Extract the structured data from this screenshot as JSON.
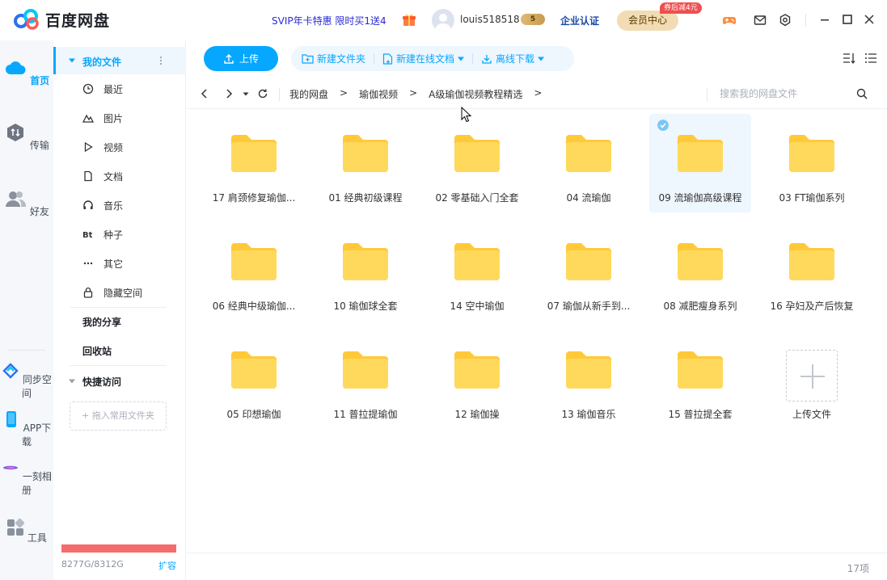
{
  "app": {
    "title": "百度网盘",
    "promo": "SVIP年卡特惠 限时买1送4",
    "username": "louis518518",
    "vip_badge": "5",
    "enterprise": "企业认证",
    "member_center": "会员中心",
    "member_tag": "券后减4元"
  },
  "rail": {
    "items": [
      {
        "label": "首页",
        "icon": "cloud-icon"
      },
      {
        "label": "传输",
        "icon": "transfer-icon"
      },
      {
        "label": "好友",
        "icon": "friends-icon"
      },
      {
        "label": "同步空间",
        "icon": "sync-icon"
      },
      {
        "label": "APP下载",
        "icon": "phone-icon"
      },
      {
        "label": "一刻相册",
        "icon": "album-icon"
      },
      {
        "label": "工具",
        "icon": "tools-icon"
      }
    ]
  },
  "sidebar": {
    "my_files": "我的文件",
    "items": [
      {
        "label": "最近",
        "icon": "clock-icon"
      },
      {
        "label": "图片",
        "icon": "image-icon"
      },
      {
        "label": "视频",
        "icon": "play-icon"
      },
      {
        "label": "文档",
        "icon": "document-icon"
      },
      {
        "label": "音乐",
        "icon": "headphone-icon"
      },
      {
        "label": "种子",
        "icon": "bt-icon"
      },
      {
        "label": "其它",
        "icon": "more-icon"
      },
      {
        "label": "隐藏空间",
        "icon": "lock-icon"
      }
    ],
    "my_share": "我的分享",
    "recycle_bin": "回收站",
    "quick_access": "快捷访问",
    "drop_hint": "+ 拖入常用文件夹",
    "storage": "8277G/8312G",
    "storage_used_fraction": 0.996,
    "expand": "扩容"
  },
  "toolbar": {
    "upload": "上传",
    "new_folder": "新建文件夹",
    "new_online_doc": "新建在线文档",
    "offline_download": "离线下载"
  },
  "breadcrumb": {
    "items": [
      "我的网盘",
      "瑜伽视频",
      "A级瑜伽视频教程精选"
    ],
    "separator": ">",
    "search_placeholder": "搜索我的网盘文件"
  },
  "files": [
    {
      "name": "17 肩颈修复瑜伽..."
    },
    {
      "name": "01 经典初级课程"
    },
    {
      "name": "02 零基础入门全套"
    },
    {
      "name": "04 流瑜伽"
    },
    {
      "name": "09 流瑜伽高级课程",
      "selected": true
    },
    {
      "name": "03 FT瑜伽系列"
    },
    {
      "name": "06 经典中级瑜伽..."
    },
    {
      "name": "10 瑜伽球全套"
    },
    {
      "name": "14 空中瑜伽"
    },
    {
      "name": "07 瑜伽从新手到..."
    },
    {
      "name": "08 减肥瘦身系列"
    },
    {
      "name": "16 孕妇及产后恢复"
    },
    {
      "name": "05 印想瑜伽"
    },
    {
      "name": "11 普拉提瑜伽"
    },
    {
      "name": "12 瑜伽操"
    },
    {
      "name": "13 瑜伽音乐"
    },
    {
      "name": "15 普拉提全套"
    }
  ],
  "upload_tile": "上传文件",
  "footer": {
    "count": "17项"
  },
  "colors": {
    "accent": "#06a7ff",
    "folder": "#ffd24d",
    "storage": "#f56c6c"
  }
}
